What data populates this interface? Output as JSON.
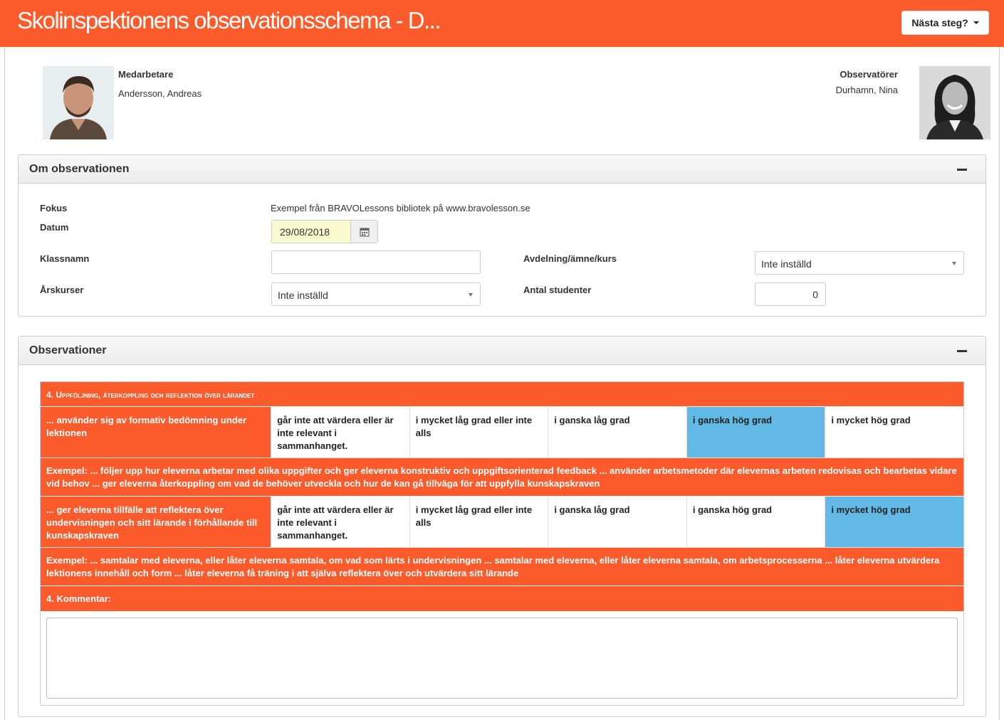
{
  "header": {
    "title": "Skolinspektionens observationsschema - D...",
    "next_label": "Nästa steg?"
  },
  "employee": {
    "label": "Medarbetare",
    "name": "Andersson, Andreas"
  },
  "observers": {
    "label": "Observatörer",
    "name": "Durhamn, Nina"
  },
  "about": {
    "title": "Om observationen",
    "focus_label": "Fokus",
    "focus_value": "Exempel från BRAVOLessons bibliotek på www.bravolesson.se",
    "date_label": "Datum",
    "date_value": "29/08/2018",
    "class_label": "Klassnamn",
    "class_value": "",
    "dept_label": "Avdelning/ämne/kurs",
    "dept_value": "Inte inställd",
    "year_label": "Årskurser",
    "year_value": "Inte inställd",
    "students_label": "Antal studenter",
    "students_value": "0"
  },
  "observations": {
    "title": "Observationer",
    "section_title": "4. Uppföljning, återkoppling och reflektion över lärandet",
    "rows": [
      {
        "lead": "... använder sig av formativ bedömning under lektionen",
        "options": [
          "går inte att värdera eller är inte relevant i sammanhanget.",
          "i mycket låg grad eller inte alls",
          "i ganska låg grad",
          "i ganska hög grad",
          "i mycket hög grad"
        ],
        "selected": 3,
        "example": "Exempel: ... följer upp hur eleverna arbetar med olika uppgifter och ger eleverna konstruktiv och uppgiftsorienterad feedback ... använder arbetsmetoder där elevernas arbeten redovisas och bearbetas vidare vid behov ... ger eleverna återkoppling om vad de behöver utveckla och hur de kan gå tillväga för att uppfylla kunskapskraven"
      },
      {
        "lead": "... ger eleverna tillfälle att reflektera över undervisningen och sitt lärande i förhållande till kunskapskraven",
        "options": [
          "går inte att värdera eller är inte relevant i sammanhanget.",
          "i mycket låg grad eller inte alls",
          "i ganska låg grad",
          "i ganska hög grad",
          "i mycket hög grad"
        ],
        "selected": 4,
        "example": "Exempel: ... samtalar med eleverna, eller låter eleverna samtala, om vad som lärts i undervisningen ... samtalar med eleverna, eller låter eleverna samtala, om arbetsprocesserna ... låter eleverna utvärdera lektionens innehåll och form ... låter eleverna få träning i att själva reflektera över och utvärdera sitt lärande"
      }
    ],
    "comment_label": "4. Kommentar:",
    "comment_value": ""
  },
  "colors": {
    "accent": "#fe5b2c",
    "selected": "#62b9e5",
    "date_bg": "#f9fbcf"
  }
}
